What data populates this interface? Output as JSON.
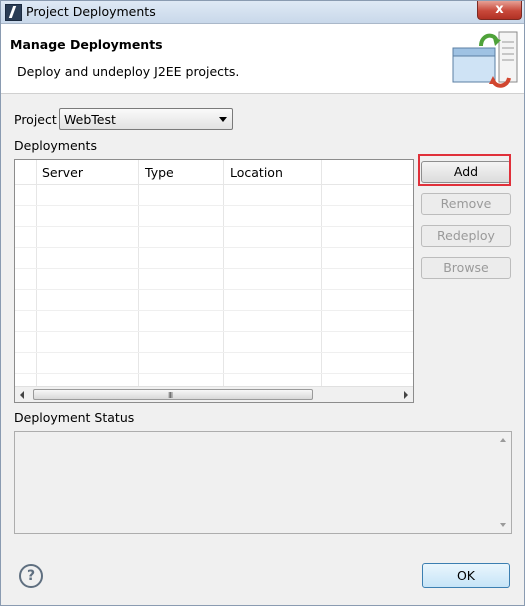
{
  "window": {
    "title": "Project Deployments",
    "close_label": "x"
  },
  "header": {
    "title": "Manage Deployments",
    "description": "Deploy and undeploy J2EE projects."
  },
  "project": {
    "label": "Project",
    "selected": "WebTest"
  },
  "deployments": {
    "label": "Deployments",
    "columns": [
      "Server",
      "Type",
      "Location"
    ],
    "rows": [],
    "scroll_grip": "III"
  },
  "buttons": {
    "add": "Add",
    "remove": "Remove",
    "redeploy": "Redeploy",
    "browse": "Browse"
  },
  "status": {
    "label": "Deployment Status",
    "text": ""
  },
  "footer": {
    "help": "?",
    "ok": "OK"
  }
}
